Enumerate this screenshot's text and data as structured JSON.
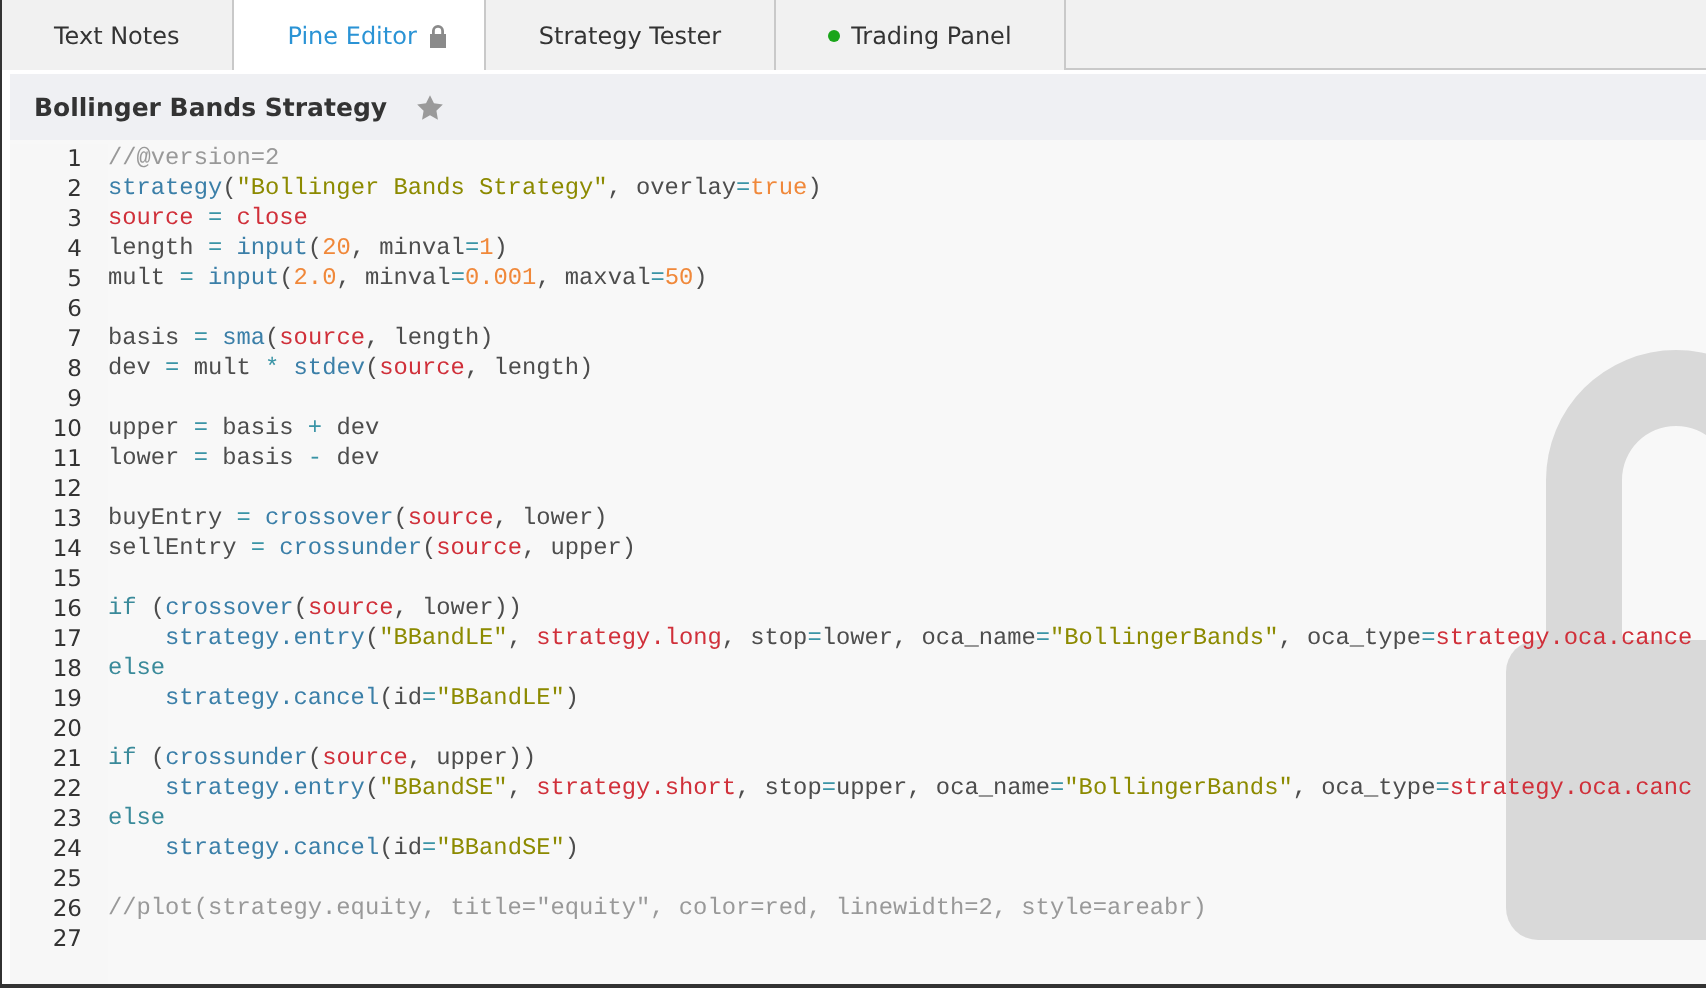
{
  "tabs": [
    {
      "label": "Text Notes",
      "selected": false,
      "locked": false
    },
    {
      "label": "Pine Editor",
      "selected": true,
      "locked": true
    },
    {
      "label": "Strategy Tester",
      "selected": false,
      "locked": false
    },
    {
      "label": "Trading Panel",
      "selected": false,
      "locked": false,
      "color": "#1aa51a"
    }
  ],
  "script": {
    "title": "Bollinger Bands Strategy",
    "starred": false
  },
  "editor": {
    "locked": true,
    "lines": [
      {
        "number": "1",
        "tokens": [
          {
            "kind": "comment",
            "text": "//@version=2"
          }
        ]
      },
      {
        "number": "2",
        "tokens": [
          {
            "kind": "function",
            "text": "strategy"
          },
          {
            "kind": "plain",
            "text": "("
          },
          {
            "kind": "string",
            "text": "\"Bollinger Bands Strategy\""
          },
          {
            "kind": "plain",
            "text": ", overlay"
          },
          {
            "kind": "operator",
            "text": "="
          },
          {
            "kind": "number",
            "text": "true"
          },
          {
            "kind": "plain",
            "text": ")"
          }
        ]
      },
      {
        "number": "3",
        "tokens": [
          {
            "kind": "variable",
            "text": "source"
          },
          {
            "kind": "operator",
            "text": " = "
          },
          {
            "kind": "variable",
            "text": "close"
          }
        ]
      },
      {
        "number": "4",
        "tokens": [
          {
            "kind": "plain",
            "text": "length "
          },
          {
            "kind": "operator",
            "text": "= "
          },
          {
            "kind": "function",
            "text": "input"
          },
          {
            "kind": "plain",
            "text": "("
          },
          {
            "kind": "number",
            "text": "20"
          },
          {
            "kind": "plain",
            "text": ", minval"
          },
          {
            "kind": "operator",
            "text": "="
          },
          {
            "kind": "number",
            "text": "1"
          },
          {
            "kind": "plain",
            "text": ")"
          }
        ]
      },
      {
        "number": "5",
        "tokens": [
          {
            "kind": "plain",
            "text": "mult "
          },
          {
            "kind": "operator",
            "text": "= "
          },
          {
            "kind": "function",
            "text": "input"
          },
          {
            "kind": "plain",
            "text": "("
          },
          {
            "kind": "number",
            "text": "2.0"
          },
          {
            "kind": "plain",
            "text": ", minval"
          },
          {
            "kind": "operator",
            "text": "="
          },
          {
            "kind": "number",
            "text": "0.001"
          },
          {
            "kind": "plain",
            "text": ", maxval"
          },
          {
            "kind": "operator",
            "text": "="
          },
          {
            "kind": "number",
            "text": "50"
          },
          {
            "kind": "plain",
            "text": ")"
          }
        ]
      },
      {
        "number": "6"
      },
      {
        "number": "7",
        "tokens": [
          {
            "kind": "plain",
            "text": "basis "
          },
          {
            "kind": "operator",
            "text": "= "
          },
          {
            "kind": "function",
            "text": "sma"
          },
          {
            "kind": "plain",
            "text": "("
          },
          {
            "kind": "variable",
            "text": "source"
          },
          {
            "kind": "plain",
            "text": ", length)"
          }
        ]
      },
      {
        "number": "8",
        "tokens": [
          {
            "kind": "plain",
            "text": "dev "
          },
          {
            "kind": "operator",
            "text": "="
          },
          {
            "kind": "plain",
            "text": " mult "
          },
          {
            "kind": "operator",
            "text": "* "
          },
          {
            "kind": "function",
            "text": "stdev"
          },
          {
            "kind": "plain",
            "text": "("
          },
          {
            "kind": "variable",
            "text": "source"
          },
          {
            "kind": "plain",
            "text": ", length)"
          }
        ]
      },
      {
        "number": "9"
      },
      {
        "number": "10",
        "tokens": [
          {
            "kind": "plain",
            "text": "upper "
          },
          {
            "kind": "operator",
            "text": "="
          },
          {
            "kind": "plain",
            "text": " basis "
          },
          {
            "kind": "operator",
            "text": "+"
          },
          {
            "kind": "plain",
            "text": " dev"
          }
        ]
      },
      {
        "number": "11",
        "tokens": [
          {
            "kind": "plain",
            "text": "lower "
          },
          {
            "kind": "operator",
            "text": "="
          },
          {
            "kind": "plain",
            "text": " basis "
          },
          {
            "kind": "operator",
            "text": "-"
          },
          {
            "kind": "plain",
            "text": " dev"
          }
        ]
      },
      {
        "number": "12"
      },
      {
        "number": "13",
        "tokens": [
          {
            "kind": "plain",
            "text": "buyEntry "
          },
          {
            "kind": "operator",
            "text": "= "
          },
          {
            "kind": "function",
            "text": "crossover"
          },
          {
            "kind": "plain",
            "text": "("
          },
          {
            "kind": "variable",
            "text": "source"
          },
          {
            "kind": "plain",
            "text": ", lower)"
          }
        ]
      },
      {
        "number": "14",
        "tokens": [
          {
            "kind": "plain",
            "text": "sellEntry "
          },
          {
            "kind": "operator",
            "text": "= "
          },
          {
            "kind": "function",
            "text": "crossunder"
          },
          {
            "kind": "plain",
            "text": "("
          },
          {
            "kind": "variable",
            "text": "source"
          },
          {
            "kind": "plain",
            "text": ", upper)"
          }
        ]
      },
      {
        "number": "15"
      },
      {
        "number": "16",
        "tokens": [
          {
            "kind": "keyword",
            "text": "if"
          },
          {
            "kind": "plain",
            "text": " ("
          },
          {
            "kind": "function",
            "text": "crossover"
          },
          {
            "kind": "plain",
            "text": "("
          },
          {
            "kind": "variable",
            "text": "source"
          },
          {
            "kind": "plain",
            "text": ", lower))"
          }
        ]
      },
      {
        "number": "17",
        "tokens": [
          {
            "kind": "function",
            "text": "    strategy.entry"
          },
          {
            "kind": "plain",
            "text": "("
          },
          {
            "kind": "string",
            "text": "\"BBandLE\""
          },
          {
            "kind": "plain",
            "text": ", "
          },
          {
            "kind": "variable",
            "text": "strategy.long"
          },
          {
            "kind": "plain",
            "text": ", stop"
          },
          {
            "kind": "operator",
            "text": "="
          },
          {
            "kind": "plain",
            "text": "lower, oca_name"
          },
          {
            "kind": "operator",
            "text": "="
          },
          {
            "kind": "string",
            "text": "\"BollingerBands\""
          },
          {
            "kind": "plain",
            "text": ", oca_type"
          },
          {
            "kind": "operator",
            "text": "="
          },
          {
            "kind": "variable",
            "text": "strategy.oca.cance"
          }
        ]
      },
      {
        "number": "18",
        "tokens": [
          {
            "kind": "keyword",
            "text": "else"
          }
        ]
      },
      {
        "number": "19",
        "tokens": [
          {
            "kind": "function",
            "text": "    strategy.cancel"
          },
          {
            "kind": "plain",
            "text": "(id"
          },
          {
            "kind": "operator",
            "text": "="
          },
          {
            "kind": "string",
            "text": "\"BBandLE\""
          },
          {
            "kind": "plain",
            "text": ")"
          }
        ]
      },
      {
        "number": "20"
      },
      {
        "number": "21",
        "tokens": [
          {
            "kind": "keyword",
            "text": "if"
          },
          {
            "kind": "plain",
            "text": " ("
          },
          {
            "kind": "function",
            "text": "crossunder"
          },
          {
            "kind": "plain",
            "text": "("
          },
          {
            "kind": "variable",
            "text": "source"
          },
          {
            "kind": "plain",
            "text": ", upper))"
          }
        ]
      },
      {
        "number": "22",
        "tokens": [
          {
            "kind": "function",
            "text": "    strategy.entry"
          },
          {
            "kind": "plain",
            "text": "("
          },
          {
            "kind": "string",
            "text": "\"BBandSE\""
          },
          {
            "kind": "plain",
            "text": ", "
          },
          {
            "kind": "variable",
            "text": "strategy.short"
          },
          {
            "kind": "plain",
            "text": ", stop"
          },
          {
            "kind": "operator",
            "text": "="
          },
          {
            "kind": "plain",
            "text": "upper, oca_name"
          },
          {
            "kind": "operator",
            "text": "="
          },
          {
            "kind": "string",
            "text": "\"BollingerBands\""
          },
          {
            "kind": "plain",
            "text": ", oca_type"
          },
          {
            "kind": "operator",
            "text": "="
          },
          {
            "kind": "variable",
            "text": "strategy.oca.canc"
          }
        ]
      },
      {
        "number": "23",
        "tokens": [
          {
            "kind": "keyword",
            "text": "else"
          }
        ]
      },
      {
        "number": "24",
        "tokens": [
          {
            "kind": "function",
            "text": "    strategy.cancel"
          },
          {
            "kind": "plain",
            "text": "(id"
          },
          {
            "kind": "operator",
            "text": "="
          },
          {
            "kind": "string",
            "text": "\"BBandSE\""
          },
          {
            "kind": "plain",
            "text": ")"
          }
        ]
      },
      {
        "number": "25"
      },
      {
        "number": "26",
        "tokens": [
          {
            "kind": "comment",
            "text": "//plot(strategy.equity, title=\"equity\", color=red, linewidth=2, style=areabr)"
          }
        ]
      },
      {
        "number": "27"
      }
    ]
  }
}
